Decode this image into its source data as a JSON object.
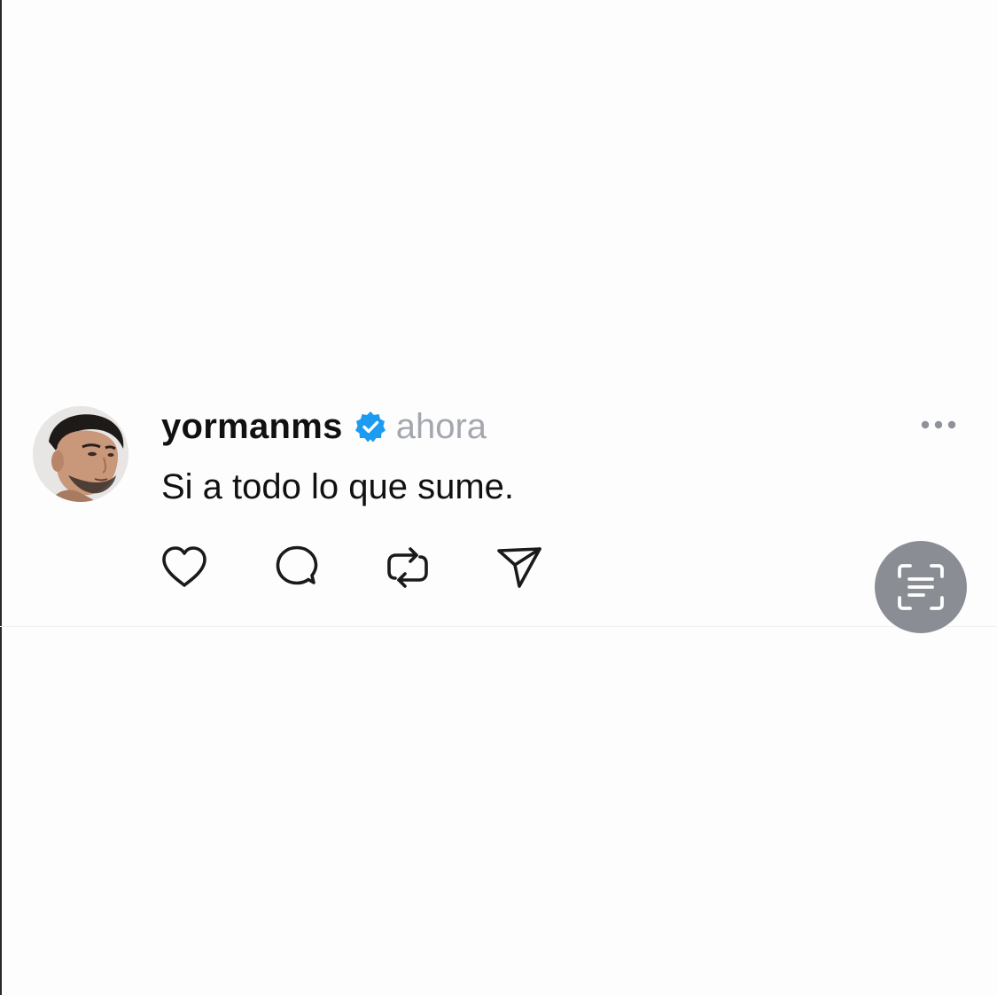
{
  "post": {
    "username": "yormanms",
    "timestamp": "ahora",
    "text": "Si a todo lo que sume.",
    "verified": true
  },
  "actions": {
    "like_icon": "heart-icon",
    "reply_icon": "comment-icon",
    "repost_icon": "repost-icon",
    "share_icon": "send-icon",
    "more_icon": "more-horizontal-icon"
  },
  "overlay": {
    "scan_icon": "scan-text-icon"
  },
  "colors": {
    "background": "#fdfdfe",
    "username": "#111111",
    "timestamp": "#a4a8ae",
    "verified_badge": "#1d9bf0",
    "icon_stroke": "#1a1a1a",
    "scan_button": "#8a8d94"
  }
}
